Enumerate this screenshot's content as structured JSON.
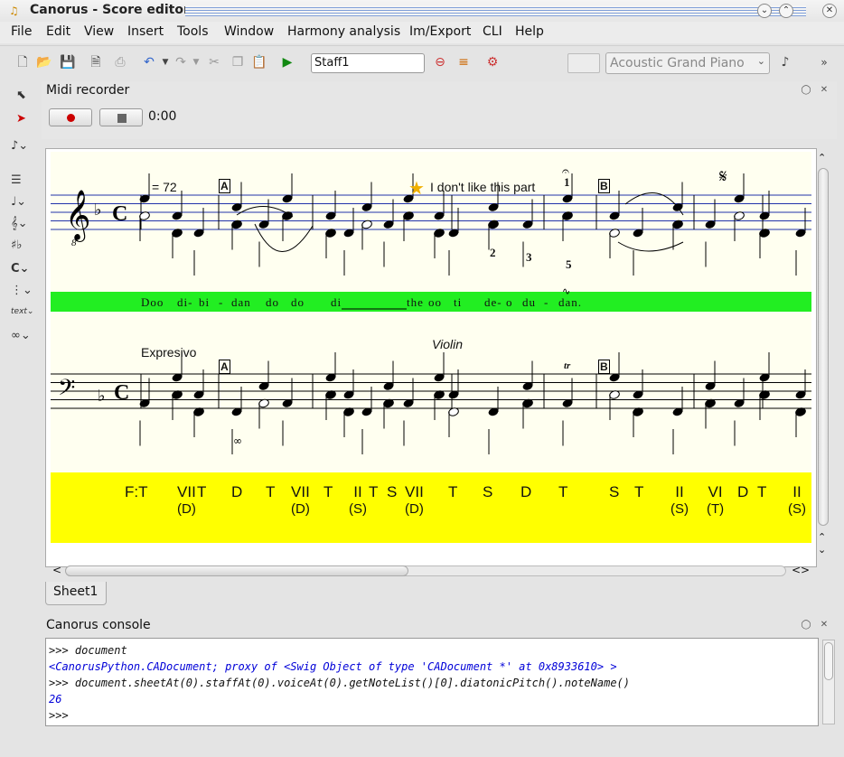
{
  "window": {
    "title": "Canorus - Score editor"
  },
  "menu": [
    "File",
    "Edit",
    "View",
    "Insert",
    "Tools",
    "Window",
    "Harmony analysis",
    "Im/Export",
    "CLI",
    "Help"
  ],
  "toolbar": {
    "staff_name": "Staff1",
    "instrument": "Acoustic Grand Piano"
  },
  "midi": {
    "title": "Midi recorder",
    "time": "0:00"
  },
  "score": {
    "tempo": "= 72",
    "rehearsal_a": "A",
    "rehearsal_b": "B",
    "comment": "I don't like this part",
    "expression": "Expresivo",
    "instrument_text": "Violin",
    "fingering": [
      "1",
      "2",
      "3",
      "5"
    ],
    "octave_mark": "8",
    "trill": "tr",
    "lyrics": [
      "Doo",
      "di-",
      "bi",
      "-",
      "dan",
      "do",
      "do",
      "di",
      "the",
      "oo",
      "ti",
      "de-",
      "o",
      "du",
      "-",
      "dan."
    ],
    "functions": [
      {
        "t": "F:T",
        "s": ""
      },
      {
        "t": "VII",
        "s": "(D)"
      },
      {
        "t": "T",
        "s": ""
      },
      {
        "t": "D",
        "s": ""
      },
      {
        "t": "T",
        "s": ""
      },
      {
        "t": "VII",
        "s": "(D)"
      },
      {
        "t": "T",
        "s": ""
      },
      {
        "t": "II",
        "s": "(S)"
      },
      {
        "t": "T",
        "s": ""
      },
      {
        "t": "S",
        "s": ""
      },
      {
        "t": "VII",
        "s": "(D)"
      },
      {
        "t": "T",
        "s": ""
      },
      {
        "t": "S",
        "s": ""
      },
      {
        "t": "D",
        "s": ""
      },
      {
        "t": "T",
        "s": ""
      },
      {
        "t": "S",
        "s": ""
      },
      {
        "t": "T",
        "s": ""
      },
      {
        "t": "II",
        "s": "(S)"
      },
      {
        "t": "VI",
        "s": "(T)"
      },
      {
        "t": "D",
        "s": ""
      },
      {
        "t": "T",
        "s": ""
      },
      {
        "t": "II",
        "s": "(S)"
      }
    ]
  },
  "tabs": {
    "sheet": "Sheet1"
  },
  "console": {
    "title": "Canorus console",
    "lines": [
      {
        "text": ">>> document",
        "kind": "in"
      },
      {
        "text": "<CanorusPython.CADocument; proxy of <Swig Object of type 'CADocument *' at 0x8933610> >",
        "kind": "out"
      },
      {
        "text": ">>> document.sheetAt(0).staffAt(0).voiceAt(0).getNoteList()[0].diatonicPitch().noteName()",
        "kind": "in"
      },
      {
        "text": "26",
        "kind": "out"
      },
      {
        "text": ">>>",
        "kind": "in"
      }
    ]
  }
}
